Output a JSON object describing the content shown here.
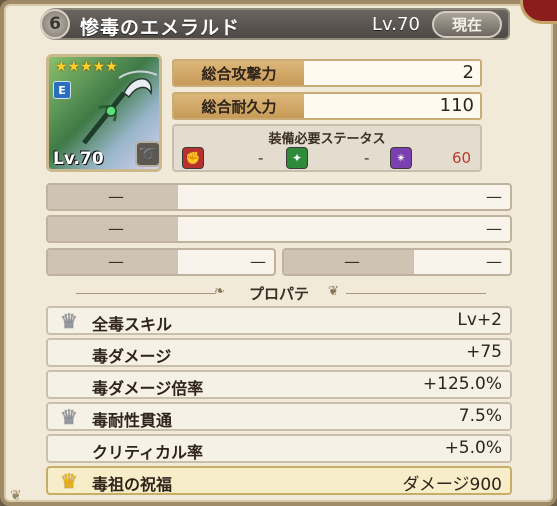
{
  "header": {
    "rank": "6",
    "item_name": "惨毒のエメラルド",
    "level": "Lv.70",
    "current_button": "現在"
  },
  "icon": {
    "stars": "★★★★★",
    "grade_badge": "E",
    "level_label": "Lv.70"
  },
  "stats": {
    "attack_label": "総合攻撃力",
    "attack_value": "2",
    "durability_label": "総合耐久力",
    "durability_value": "110"
  },
  "requirements": {
    "title": "装備必要ステータス",
    "red_value": "-",
    "green_value": "-",
    "purple_value": "60",
    "purple_color": "#c0392b"
  },
  "slots": {
    "dash": "—"
  },
  "properties": {
    "title": "プロパティ",
    "rows": [
      {
        "name": "全毒スキル",
        "value": "Lv+2",
        "crown": "silver"
      },
      {
        "name": "毒ダメージ",
        "value": "+75",
        "crown": ""
      },
      {
        "name": "毒ダメージ倍率",
        "value": "+125.0%",
        "crown": ""
      },
      {
        "name": "毒耐性貫通",
        "value": "7.5%",
        "crown": "silver"
      },
      {
        "name": "クリティカル率",
        "value": "+5.0%",
        "crown": ""
      },
      {
        "name": "毒祖の祝福",
        "value": "ダメージ900",
        "crown": "gold"
      }
    ]
  },
  "colors": {
    "accent_gold": "#c79a57",
    "frame": "#a08b68"
  }
}
